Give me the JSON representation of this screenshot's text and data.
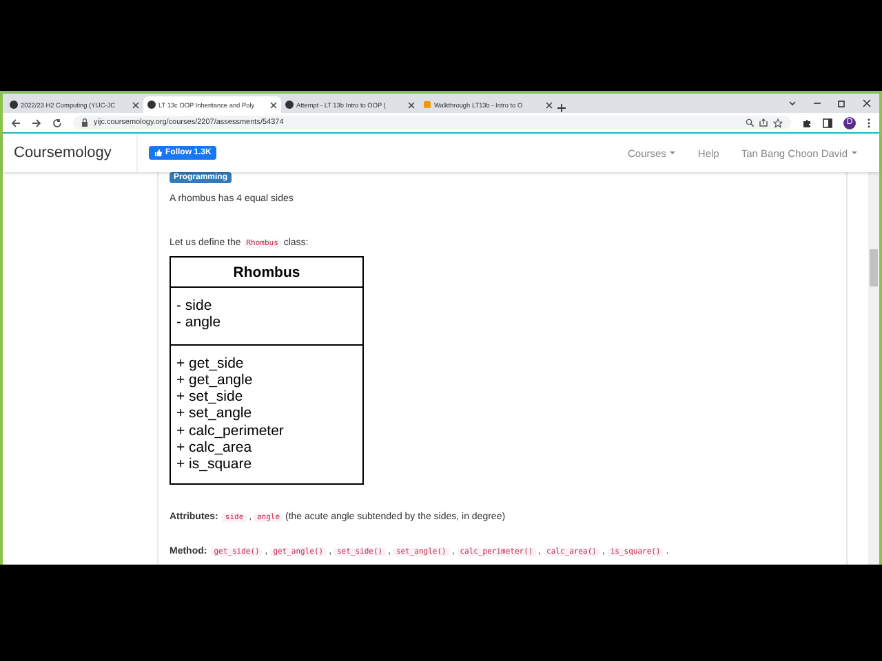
{
  "browser": {
    "tabs": [
      {
        "title": "2022/23 H2 Computing (YIJC-JC",
        "selected": false
      },
      {
        "title": "LT 13c OOP Inheritance and Poly",
        "selected": true
      },
      {
        "title": "Attempt - LT 13b Intro to OOP (",
        "selected": false
      },
      {
        "title": "Walkthrough LT13b - Intro to O",
        "selected": false
      }
    ],
    "url": "yijc.coursemology.org/courses/2207/assessments/54374",
    "profile": "D"
  },
  "navbar": {
    "brand": "Coursemology",
    "follow": "Follow 1.3K",
    "items": [
      {
        "label": "Courses",
        "dropdown": true
      },
      {
        "label": "Help",
        "dropdown": false
      },
      {
        "label": "Tan Bang Choon David",
        "dropdown": true
      }
    ]
  },
  "content": {
    "badge": "Programming",
    "paragraphs": [
      [
        {
          "kind": "text",
          "text": "A rhombus has 4 equal sides"
        }
      ],
      [
        {
          "kind": "text",
          "text": "Let us define the "
        },
        {
          "kind": "code",
          "text": "Rhombus"
        },
        {
          "kind": "text",
          "text": " class:"
        }
      ]
    ],
    "uml": {
      "name": "Rhombus",
      "attributes": [
        "- side",
        "- angle"
      ],
      "methods": [
        "+ get_side",
        "+ get_angle",
        "+ set_side",
        "+ set_angle",
        "+ calc_perimeter",
        "+ calc_area",
        "+ is_square"
      ]
    },
    "details": [
      [
        {
          "kind": "bold",
          "text": "Attributes:"
        },
        {
          "kind": "code",
          "text": "side"
        },
        {
          "kind": "text",
          "text": " , "
        },
        {
          "kind": "code",
          "text": "angle"
        },
        {
          "kind": "text",
          "text": " (the acute angle subtended by the sides, in degree)"
        }
      ],
      [
        {
          "kind": "bold",
          "text": "Method:"
        },
        {
          "kind": "code",
          "text": "get_side()"
        },
        {
          "kind": "text",
          "text": " , "
        },
        {
          "kind": "code",
          "text": "get_angle()"
        },
        {
          "kind": "text",
          "text": " , "
        },
        {
          "kind": "code",
          "text": "set_side()"
        },
        {
          "kind": "text",
          "text": " , "
        },
        {
          "kind": "code",
          "text": "set_angle()"
        },
        {
          "kind": "text",
          "text": " , "
        },
        {
          "kind": "code",
          "text": "calc_perimeter()"
        },
        {
          "kind": "text",
          "text": " , "
        },
        {
          "kind": "code",
          "text": "calc_area()"
        },
        {
          "kind": "text",
          "text": " , "
        },
        {
          "kind": "code",
          "text": "is_square()"
        },
        {
          "kind": "text",
          "text": " ."
        }
      ]
    ]
  }
}
